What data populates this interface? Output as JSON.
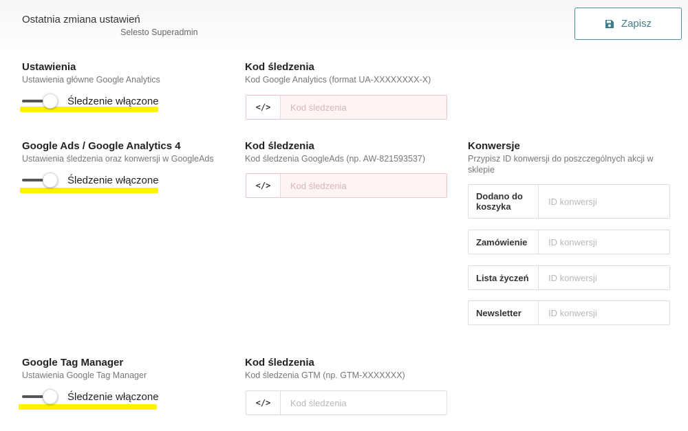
{
  "header": {
    "last_change_label": "Ostatnia zmiana ustawień",
    "last_change_user": "Selesto Superadmin",
    "save_label": "Zapisz"
  },
  "sections": [
    {
      "title": "Ustawienia",
      "desc": "Ustawienia główne Google Analytics",
      "toggle_label": "Śledzenie włączone",
      "toggle_on": true,
      "code_title": "Kod śledzenia",
      "code_desc": "Kod Google Analytics (format UA-XXXXXXXX-X)",
      "code_value": "",
      "code_placeholder": "Kod śledzenia",
      "code_addon": "</>"
    },
    {
      "title": "Google Ads / Google Analytics 4",
      "desc": "Ustawienia śledzenia oraz konwersji w GoogleAds",
      "toggle_label": "Śledzenie włączone",
      "toggle_on": true,
      "code_title": "Kod śledzenia",
      "code_desc": "Kod śledzenia GoogleAds (np. AW-821593537)",
      "code_value": "",
      "code_placeholder": "Kod śledzenia",
      "code_addon": "</>"
    },
    {
      "title": "Google Tag Manager",
      "desc": "Ustawienia Google Tag Manager",
      "toggle_label": "Śledzenie włączone",
      "toggle_on": true,
      "code_title": "Kod śledzenia",
      "code_desc": "Kod śledzenia GTM (np. GTM-XXXXXXX)",
      "code_value": "",
      "code_placeholder": "Kod śledzenia",
      "code_addon": "</>"
    }
  ],
  "conversions": {
    "title": "Konwersje",
    "desc": "Przypisz ID konwersji do poszczególnych akcji w sklepie",
    "rows": [
      {
        "label": "Dodano do koszyka",
        "value": "",
        "placeholder": "ID konwersji"
      },
      {
        "label": "Zamówienie",
        "value": "",
        "placeholder": "ID konwersji"
      },
      {
        "label": "Lista życzeń",
        "value": "",
        "placeholder": "ID konwersji"
      },
      {
        "label": "Newsletter",
        "value": "",
        "placeholder": "ID konwersji"
      }
    ]
  },
  "colors": {
    "accent": "#3f7f8c",
    "highlight": "#fff200",
    "error_bg": "#fff3f3"
  },
  "icons": {
    "save": "floppy-disk-icon",
    "code": "code-icon"
  }
}
